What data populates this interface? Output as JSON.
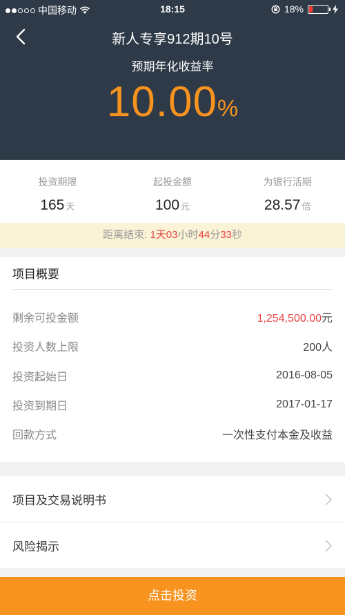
{
  "status_bar": {
    "carrier": "中国移动",
    "time": "18:15",
    "battery_text": "18%",
    "battery_level": 0.18
  },
  "header": {
    "title": "新人专享912期10号",
    "rate_label": "预期年化收益率",
    "rate_value": "10.00",
    "rate_unit": "%"
  },
  "stats": [
    {
      "label": "投资期限",
      "value": "165",
      "unit": "天"
    },
    {
      "label": "起投金额",
      "value": "100",
      "unit": "元"
    },
    {
      "label": "为银行活期",
      "value": "28.57",
      "unit": "倍"
    }
  ],
  "countdown": {
    "prefix": "距离结束:",
    "days": "1",
    "days_unit": "天",
    "hours": "03",
    "hours_unit": "小时",
    "minutes": "44",
    "minutes_unit": "分",
    "seconds": "33",
    "seconds_unit": "秒"
  },
  "overview": {
    "title": "项目概要",
    "rows": [
      {
        "label": "剩余可投金额",
        "value": "1,254,500.00",
        "suffix": "元"
      },
      {
        "label": "投资人数上限",
        "value": "200人",
        "suffix": ""
      },
      {
        "label": "投资起始日",
        "value": "2016-08-05",
        "suffix": ""
      },
      {
        "label": "投资到期日",
        "value": "2017-01-17",
        "suffix": ""
      },
      {
        "label": "回款方式",
        "value": "一次性支付本金及收益",
        "suffix": ""
      }
    ]
  },
  "links": [
    {
      "label": "项目及交易说明书"
    },
    {
      "label": "风险揭示"
    }
  ],
  "invest_button": {
    "label": "点击投资"
  },
  "colors": {
    "header_bg": "#2e3a48",
    "accent": "#f7931e",
    "highlight": "#e84444",
    "countdown_bg": "#fbf3d6"
  }
}
